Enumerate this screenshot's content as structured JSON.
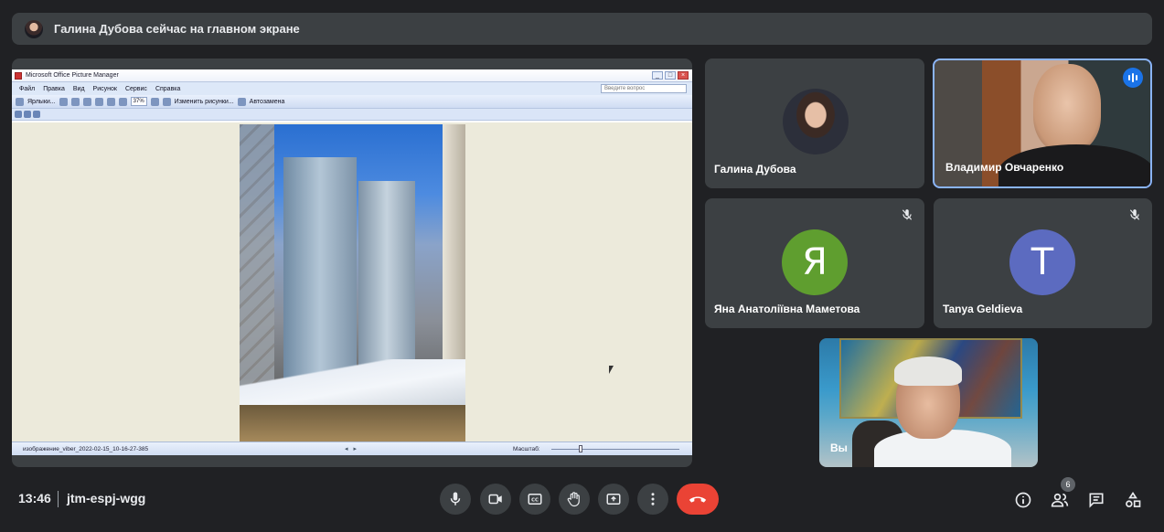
{
  "banner": {
    "text": "Галина Дубова сейчас на главном экране"
  },
  "presentation": {
    "window_title": "Microsoft Office Picture Manager",
    "menu": [
      "Файл",
      "Правка",
      "Вид",
      "Рисунок",
      "Сервис",
      "Справка"
    ],
    "ask_placeholder": "Введите вопрос",
    "toolbar_shortcuts": "Ярлыки...",
    "toolbar_zoom": "37%",
    "toolbar_edit": "Изменить рисунки...",
    "toolbar_autofix": "Автозамена",
    "file_name": "изображение_viber_2022-02-15_10-16-27-385",
    "zoom_label": "Масштаб:"
  },
  "participants": [
    {
      "name": "Галина Дубова",
      "avatar_letter": "",
      "muted": false
    },
    {
      "name": "Владимир Овчаренко",
      "speaking": true
    },
    {
      "name": "Яна Анатоліївна Маметова",
      "avatar_letter": "Я",
      "avatar_color": "#5f9e2f",
      "muted": true
    },
    {
      "name": "Tanya Geldieva",
      "avatar_letter": "T",
      "avatar_color": "#5c6bc0",
      "muted": true
    },
    {
      "name": "Вы"
    }
  ],
  "footer": {
    "time": "13:46",
    "meeting_code": "jtm-espj-wgg",
    "participant_count": "6"
  },
  "colors": {
    "end_call": "#ea4335",
    "active_speaker": "#1a73e8"
  }
}
